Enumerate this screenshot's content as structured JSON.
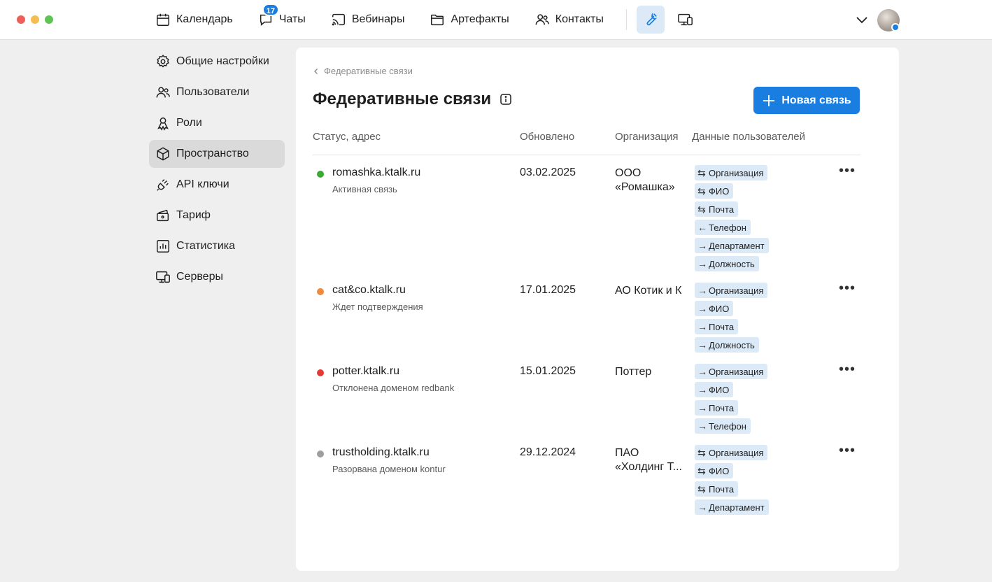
{
  "nav": {
    "calendar": "Календарь",
    "chats": "Чаты",
    "chats_badge": "17",
    "webinars": "Вебинары",
    "artifacts": "Артефакты",
    "contacts": "Контакты"
  },
  "sidebar": {
    "items": [
      {
        "label": "Общие настройки",
        "icon": "gear-icon"
      },
      {
        "label": "Пользователи",
        "icon": "users-icon"
      },
      {
        "label": "Роли",
        "icon": "roles-icon"
      },
      {
        "label": "Пространство",
        "icon": "cube-icon",
        "active": true
      },
      {
        "label": "API ключи",
        "icon": "plug-icon"
      },
      {
        "label": "Тариф",
        "icon": "tariff-icon"
      },
      {
        "label": "Статистика",
        "icon": "stats-icon"
      },
      {
        "label": "Серверы",
        "icon": "servers-icon"
      }
    ]
  },
  "main": {
    "breadcrumb": "Федеративные связи",
    "title": "Федеративные связи",
    "new_button": "Новая связь",
    "columns": {
      "status": "Статус, адрес",
      "updated": "Обновлено",
      "org": "Организация",
      "data": "Данные пользователей"
    },
    "rows": [
      {
        "address": "romashka.ktalk.ru",
        "status": "Активная связь",
        "status_color": "#3aaa35",
        "date": "03.02.2025",
        "org": "ООО «Ромашка»",
        "tags": [
          {
            "arrow": "⇆",
            "label": "Организация"
          },
          {
            "arrow": "⇆",
            "label": "ФИО"
          },
          {
            "arrow": "⇆",
            "label": "Почта"
          },
          {
            "arrow": "←",
            "label": "Телефон"
          },
          {
            "arrow": "→",
            "label": "Департамент"
          },
          {
            "arrow": "→",
            "label": "Должность"
          }
        ]
      },
      {
        "address": "cat&co.ktalk.ru",
        "status": "Ждет подтверждения",
        "status_color": "#f08a3c",
        "date": "17.01.2025",
        "org": "АО Котик и К",
        "tags": [
          {
            "arrow": "→",
            "label": "Организация"
          },
          {
            "arrow": "→",
            "label": "ФИО"
          },
          {
            "arrow": "→",
            "label": "Почта"
          },
          {
            "arrow": "→",
            "label": "Должность"
          }
        ]
      },
      {
        "address": "potter.ktalk.ru",
        "status": "Отклонена доменом redbank",
        "status_color": "#e53935",
        "date": "15.01.2025",
        "org": "Поттер",
        "tags": [
          {
            "arrow": "→",
            "label": "Организация"
          },
          {
            "arrow": "→",
            "label": "ФИО"
          },
          {
            "arrow": "→",
            "label": "Почта"
          },
          {
            "arrow": "→",
            "label": "Телефон"
          }
        ]
      },
      {
        "address": "trustholding.ktalk.ru",
        "status": "Разорвана доменом kontur",
        "status_color": "#9e9e9e",
        "date": "29.12.2024",
        "org": "ПАО «Холдинг Т...",
        "tags": [
          {
            "arrow": "⇆",
            "label": "Организация"
          },
          {
            "arrow": "⇆",
            "label": "ФИО"
          },
          {
            "arrow": "⇆",
            "label": "Почта"
          },
          {
            "arrow": "→",
            "label": "Департамент"
          }
        ]
      }
    ]
  },
  "colors": {
    "accent": "#1a7de0",
    "tag_bg": "#dceaf7"
  }
}
